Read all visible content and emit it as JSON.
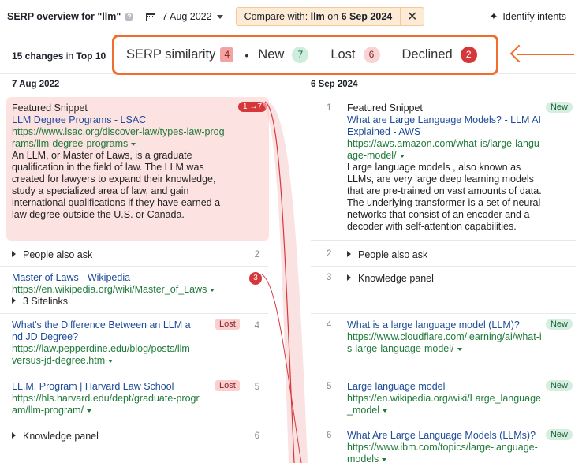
{
  "topbar": {
    "title": "SERP overview for \"llm\"",
    "date": "7 Aug 2022",
    "compare_prefix": "Compare with:",
    "compare_keyword": "llm",
    "compare_on": "on",
    "compare_date": "6 Sep 2024",
    "close_symbol": "✕",
    "identify_label": "Identify intents",
    "help_symbol": "?",
    "sparkle_symbol": "✦"
  },
  "summary": {
    "changes_count": "15 changes",
    "changes_in": "in",
    "changes_scope": "Top 10",
    "similarity_label": "SERP similarity",
    "similarity_value": "4",
    "new_label": "New",
    "new_value": "7",
    "lost_label": "Lost",
    "lost_value": "6",
    "declined_label": "Declined",
    "declined_value": "2",
    "separator": "•"
  },
  "colors": {
    "accent_orange": "#f26c2b",
    "lost_bg": "#f9cfcf",
    "new_bg": "#d4efdf",
    "declined_red": "#d6383a",
    "similarity_bg": "#f4a3a3",
    "featured_bg": "#fde2e2"
  },
  "left": {
    "date": "7 Aug 2022",
    "rows": [
      {
        "type": "Featured Snippet",
        "badge": "1 →7",
        "title": "LLM Degree Programs - LSAC",
        "url": "https://www.lsac.org/discover-law/types-law-programs/llm-degree-programs",
        "desc": "An LLM, or Master of Laws, is a graduate qualification in the field of law. The LLM was created for lawyers to expand their knowledge, study a specialized area of law, and gain international qualifications if they have earned a law degree outside the U.S. or Canada."
      },
      {
        "label": "People also ask",
        "rank": "2"
      },
      {
        "title": "Master of Laws - Wikipedia",
        "url": "https://en.wikipedia.org/wiki/Master_of_Laws",
        "sitelinks": "3 Sitelinks",
        "badge": "3"
      },
      {
        "title": "What's the Difference Between an LLM and JD Degree?",
        "url": "https://law.pepperdine.edu/blog/posts/llm-versus-jd-degree.htm",
        "tag": "Lost",
        "rank": "4"
      },
      {
        "title": "LL.M. Program | Harvard Law School",
        "url": "https://hls.harvard.edu/dept/graduate-program/llm-program/",
        "tag": "Lost",
        "rank": "5"
      },
      {
        "label": "Knowledge panel",
        "rank": "6"
      }
    ]
  },
  "right": {
    "date": "6 Sep 2024",
    "rows": [
      {
        "num": "1",
        "type": "Featured Snippet",
        "tag": "New",
        "title": "What are Large Language Models? - LLM AI Explained - AWS",
        "url": "https://aws.amazon.com/what-is/large-language-model/",
        "desc": "Large language models , also known as LLMs, are very large deep learning models that are pre-trained on vast amounts of data. The underlying transformer is a set of neural networks that consist of an encoder and a decoder with self-attention capabilities."
      },
      {
        "num": "2",
        "label": "People also ask"
      },
      {
        "num": "3",
        "label": "Knowledge panel"
      },
      {
        "num": "4",
        "title": "What is a large language model (LLM)?",
        "url": "https://www.cloudflare.com/learning/ai/what-is-large-language-model/",
        "tag": "New"
      },
      {
        "num": "5",
        "title": "Large language model",
        "url": "https://en.wikipedia.org/wiki/Large_language_model",
        "tag": "New"
      },
      {
        "num": "6",
        "title": "What Are Large Language Models (LLMs)?",
        "url": "https://www.ibm.com/topics/large-language-models",
        "tag": "New"
      }
    ]
  }
}
